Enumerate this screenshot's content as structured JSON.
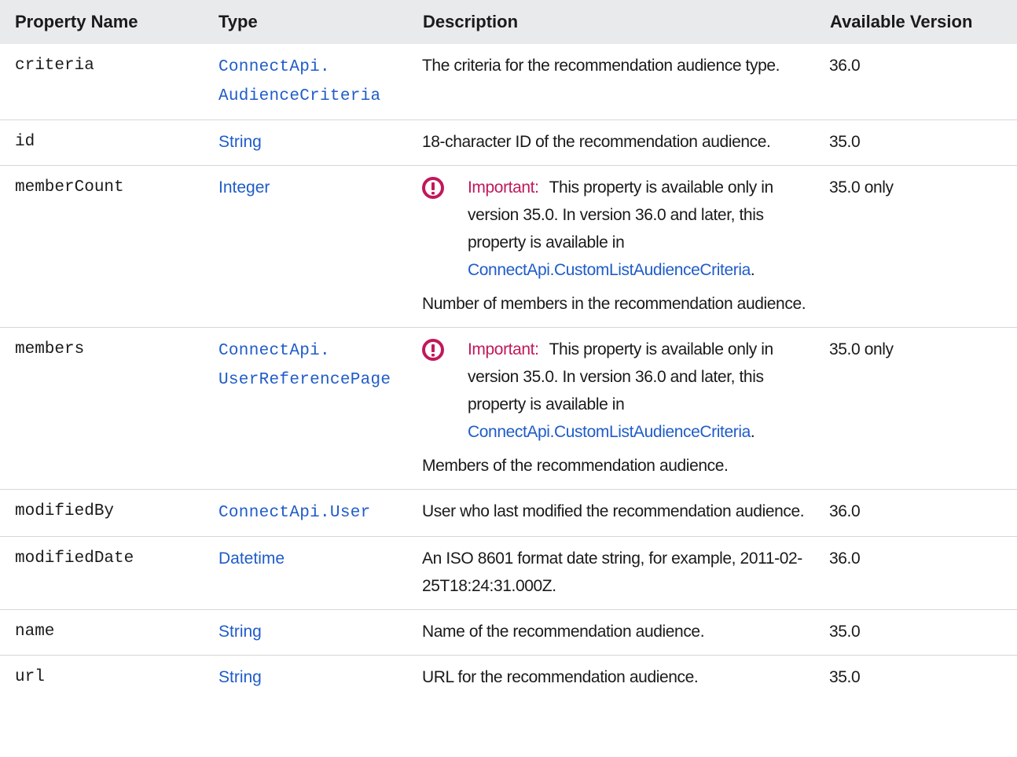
{
  "table": {
    "headers": {
      "property_name": "Property Name",
      "type": "Type",
      "description": "Description",
      "available_version": "Available Version"
    },
    "rows": [
      {
        "property": "criteria",
        "type_line1": "ConnectApi.",
        "type_line2": "AudienceCriteria",
        "description": "The criteria for the recommendation audience type.",
        "version": "36.0"
      },
      {
        "property": "id",
        "type": "String",
        "description": "18-character ID of the recommendation audience.",
        "version": "35.0"
      },
      {
        "property": "memberCount",
        "type": "Integer",
        "important_label": "Important:",
        "important_text": "This property is available only in version 35.0. In version 36.0 and later, this property is available in",
        "important_link": "ConnectApi.CustomListAudienceCriteria",
        "important_end": ".",
        "description": "Number of members in the recommendation audience.",
        "version": "35.0 only"
      },
      {
        "property": "members",
        "type_line1": "ConnectApi.",
        "type_line2": "UserReferencePage",
        "important_label": "Important:",
        "important_text": "This property is available only in version 35.0. In version 36.0 and later, this property is available in",
        "important_link": "ConnectApi.CustomListAudienceCriteria",
        "important_end": ".",
        "description": "Members of the recommendation audience.",
        "version": "35.0 only"
      },
      {
        "property": "modifiedBy",
        "type": "ConnectApi.User",
        "description": "User who last modified the recommendation audience.",
        "version": "36.0"
      },
      {
        "property": "modifiedDate",
        "type": "Datetime",
        "description": "An ISO 8601 format date string, for example, 2011-02-25T18:24:31.000Z.",
        "version": "36.0"
      },
      {
        "property": "name",
        "type": "String",
        "description": "Name of the recommendation audience.",
        "version": "35.0"
      },
      {
        "property": "url",
        "type": "String",
        "description": "URL for the recommendation audience.",
        "version": "35.0"
      }
    ]
  },
  "colors": {
    "link": "#1f5cc9",
    "important": "#c2185b",
    "header_bg": "#e9eaec"
  },
  "icons": {
    "important": "exclamation-circle-icon"
  }
}
